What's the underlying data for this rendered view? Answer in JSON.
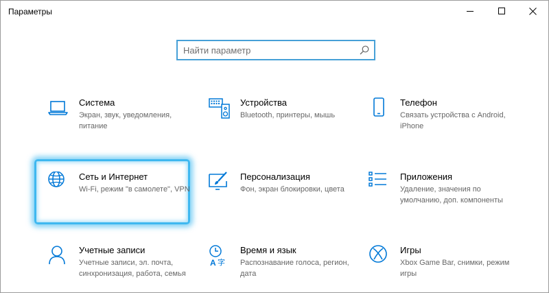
{
  "window": {
    "title": "Параметры"
  },
  "search": {
    "placeholder": "Найти параметр"
  },
  "colors": {
    "accent": "#0078d7",
    "highlight": "#3fb8f0",
    "description": "#666666"
  },
  "tiles": [
    {
      "title": "Система",
      "description": "Экран, звук, уведомления, питание",
      "icon": "laptop-icon"
    },
    {
      "title": "Устройства",
      "description": "Bluetooth, принтеры, мышь",
      "icon": "keyboard-speaker-icon"
    },
    {
      "title": "Телефон",
      "description": "Связать устройства с Android, iPhone",
      "icon": "phone-icon"
    },
    {
      "title": "Сеть и Интернет",
      "description": "Wi-Fi, режим \"в самолете\", VPN",
      "icon": "globe-icon"
    },
    {
      "title": "Персонализация",
      "description": "Фон, экран блокировки, цвета",
      "icon": "paint-brush-icon"
    },
    {
      "title": "Приложения",
      "description": "Удаление, значения по умолчанию, доп. компоненты",
      "icon": "apps-list-icon"
    },
    {
      "title": "Учетные записи",
      "description": "Учетные записи, эл. почта, синхронизация, работа, семья",
      "icon": "person-icon"
    },
    {
      "title": "Время и язык",
      "description": "Распознавание голоса, регион, дата",
      "icon": "time-language-icon"
    },
    {
      "title": "Игры",
      "description": "Xbox Game Bar, снимки, режим игры",
      "icon": "xbox-icon"
    }
  ]
}
